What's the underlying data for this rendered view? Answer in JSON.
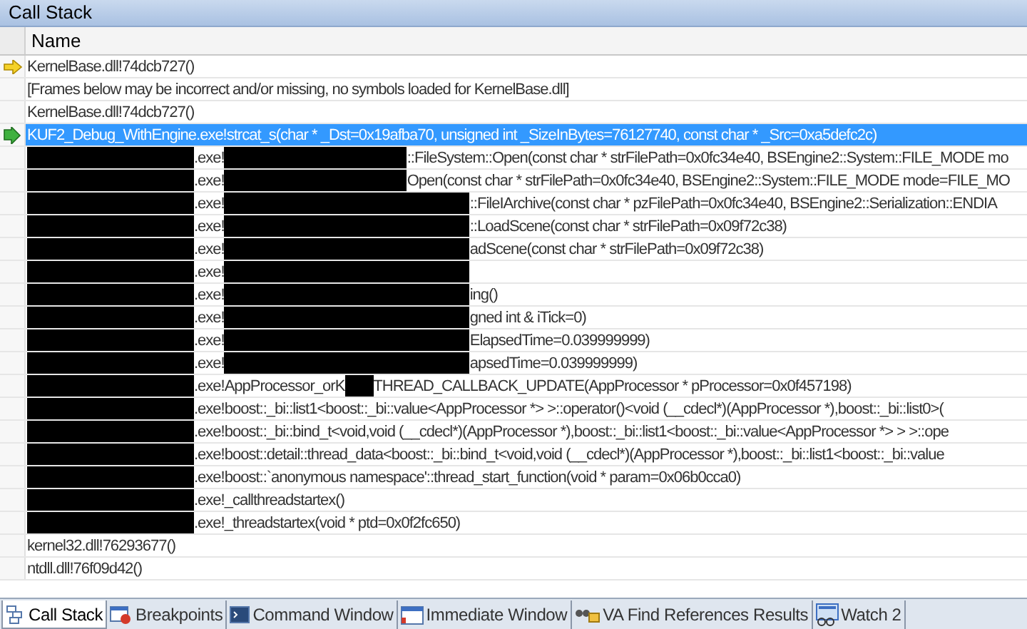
{
  "window": {
    "title": "Call Stack"
  },
  "table": {
    "columns": [
      "Name"
    ],
    "rows": [
      {
        "active": true,
        "selected": false,
        "segments": [
          {
            "kind": "text",
            "text": "KernelBase.dll!74dcb727()"
          }
        ]
      },
      {
        "active": false,
        "selected": false,
        "segments": [
          {
            "kind": "text",
            "text": "[Frames below may be incorrect and/or missing, no symbols loaded for KernelBase.dll]"
          }
        ]
      },
      {
        "active": false,
        "selected": false,
        "segments": [
          {
            "kind": "text",
            "text": "KernelBase.dll!74dcb727()"
          }
        ]
      },
      {
        "active": false,
        "selected": true,
        "segments": [
          {
            "kind": "text",
            "text": "KUF2_Debug_WithEngine.exe!strcat_s(char * _Dst=0x19afba70, unsigned int _SizeInBytes=76127740, const char * _Src=0xa5defc2c)"
          }
        ]
      },
      {
        "active": false,
        "selected": false,
        "segments": [
          {
            "kind": "block_module"
          },
          {
            "kind": "text",
            "text": ".exe!"
          },
          {
            "kind": "block_narrow"
          },
          {
            "kind": "text",
            "text": "::FileSystem::Open(const char * strFilePath=0x0fc34e40, BSEngine2::System::FILE_MODE mo"
          }
        ]
      },
      {
        "active": false,
        "selected": false,
        "segments": [
          {
            "kind": "block_module"
          },
          {
            "kind": "text",
            "text": ".exe!"
          },
          {
            "kind": "block_narrow"
          },
          {
            "kind": "text",
            "text": "Open(const char * strFilePath=0x0fc34e40, BSEngine2::System::FILE_MODE mode=FILE_MO"
          }
        ]
      },
      {
        "active": false,
        "selected": false,
        "segments": [
          {
            "kind": "block_module"
          },
          {
            "kind": "text",
            "text": ".exe!"
          },
          {
            "kind": "block_wide"
          },
          {
            "kind": "text",
            "text": "::FileIArchive(const char * pzFilePath=0x0fc34e40, BSEngine2::Serialization::ENDIA"
          }
        ]
      },
      {
        "active": false,
        "selected": false,
        "segments": [
          {
            "kind": "block_module"
          },
          {
            "kind": "text",
            "text": ".exe!"
          },
          {
            "kind": "block_wide"
          },
          {
            "kind": "text",
            "text": "::LoadScene(const char * strFilePath=0x09f72c38)"
          }
        ]
      },
      {
        "active": false,
        "selected": false,
        "segments": [
          {
            "kind": "block_module"
          },
          {
            "kind": "text",
            "text": ".exe!"
          },
          {
            "kind": "block_wide"
          },
          {
            "kind": "text",
            "text": "adScene(const char * strFilePath=0x09f72c38)"
          }
        ]
      },
      {
        "active": false,
        "selected": false,
        "segments": [
          {
            "kind": "block_module"
          },
          {
            "kind": "text",
            "text": ".exe!"
          },
          {
            "kind": "block_wide"
          }
        ]
      },
      {
        "active": false,
        "selected": false,
        "segments": [
          {
            "kind": "block_module"
          },
          {
            "kind": "text",
            "text": ".exe!"
          },
          {
            "kind": "block_wide"
          },
          {
            "kind": "text",
            "text": "ing()"
          }
        ]
      },
      {
        "active": false,
        "selected": false,
        "segments": [
          {
            "kind": "block_module"
          },
          {
            "kind": "text",
            "text": ".exe!"
          },
          {
            "kind": "block_wide"
          },
          {
            "kind": "text",
            "text": "gned int & iTick=0)"
          }
        ]
      },
      {
        "active": false,
        "selected": false,
        "segments": [
          {
            "kind": "block_module"
          },
          {
            "kind": "text",
            "text": ".exe!"
          },
          {
            "kind": "block_wide"
          },
          {
            "kind": "text",
            "text": "ElapsedTime=0.039999999)"
          }
        ]
      },
      {
        "active": false,
        "selected": false,
        "segments": [
          {
            "kind": "block_module"
          },
          {
            "kind": "text",
            "text": ".exe!"
          },
          {
            "kind": "block_wide"
          },
          {
            "kind": "text",
            "text": "apsedTime=0.039999999)"
          }
        ]
      },
      {
        "active": false,
        "selected": false,
        "segments": [
          {
            "kind": "block_module"
          },
          {
            "kind": "text",
            "text": ".exe!AppProcessor_orK"
          },
          {
            "kind": "block_small"
          },
          {
            "kind": "text",
            "text": "THREAD_CALLBACK_UPDATE(AppProcessor * pProcessor=0x0f457198)"
          }
        ]
      },
      {
        "active": false,
        "selected": false,
        "segments": [
          {
            "kind": "block_module"
          },
          {
            "kind": "text",
            "text": ".exe!boost::_bi::list1<boost::_bi::value<AppProcessor *> >::operator()<void (__cdecl*)(AppProcessor *),boost::_bi::list0>("
          }
        ]
      },
      {
        "active": false,
        "selected": false,
        "segments": [
          {
            "kind": "block_module"
          },
          {
            "kind": "text",
            "text": ".exe!boost::_bi::bind_t<void,void (__cdecl*)(AppProcessor *),boost::_bi::list1<boost::_bi::value<AppProcessor *> > >::ope"
          }
        ]
      },
      {
        "active": false,
        "selected": false,
        "segments": [
          {
            "kind": "block_module"
          },
          {
            "kind": "text",
            "text": ".exe!boost::detail::thread_data<boost::_bi::bind_t<void,void (__cdecl*)(AppProcessor *),boost::_bi::list1<boost::_bi::value"
          }
        ]
      },
      {
        "active": false,
        "selected": false,
        "segments": [
          {
            "kind": "block_module"
          },
          {
            "kind": "text",
            "text": ".exe!boost::`anonymous namespace'::thread_start_function(void * param=0x06b0cca0)"
          }
        ]
      },
      {
        "active": false,
        "selected": false,
        "segments": [
          {
            "kind": "block_module"
          },
          {
            "kind": "text",
            "text": ".exe!_callthreadstartex()"
          }
        ]
      },
      {
        "active": false,
        "selected": false,
        "segments": [
          {
            "kind": "block_module"
          },
          {
            "kind": "text",
            "text": ".exe!_threadstartex(void * ptd=0x0f2fc650)"
          }
        ]
      },
      {
        "active": false,
        "selected": false,
        "segments": [
          {
            "kind": "text",
            "text": "kernel32.dll!76293677()"
          }
        ]
      },
      {
        "active": false,
        "selected": false,
        "segments": [
          {
            "kind": "text",
            "text": "ntdll.dll!76f09d42()"
          }
        ]
      }
    ]
  },
  "tabs": [
    {
      "label": "Call Stack",
      "selected": true
    },
    {
      "label": "Breakpoints",
      "selected": false
    },
    {
      "label": "Command Window",
      "selected": false
    },
    {
      "label": "Immediate Window",
      "selected": false
    },
    {
      "label": "VA Find References Results",
      "selected": false
    },
    {
      "label": "Watch 2",
      "selected": false
    }
  ]
}
